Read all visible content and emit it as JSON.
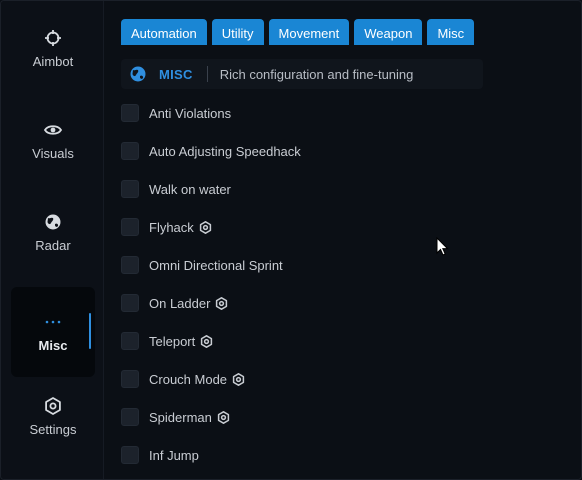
{
  "colors": {
    "accent": "#1a86d4",
    "accent_text": "#2f8fe0",
    "background": "#0b0f15"
  },
  "sidebar": {
    "items": [
      {
        "label": "Aimbot",
        "icon": "crosshair-icon",
        "active": false
      },
      {
        "label": "Visuals",
        "icon": "eye-icon",
        "active": false
      },
      {
        "label": "Radar",
        "icon": "globe-icon",
        "active": false
      },
      {
        "label": "Misc",
        "icon": "dots-icon",
        "active": true
      },
      {
        "label": "Settings",
        "icon": "settings-gear-icon",
        "active": false
      }
    ]
  },
  "tabs": [
    "Automation",
    "Utility",
    "Movement",
    "Weapon",
    "Misc"
  ],
  "section": {
    "title": "MISC",
    "description": "Rich configuration and fine-tuning",
    "icon": "globe-icon"
  },
  "options": [
    {
      "label": "Anti Violations",
      "checked": false,
      "has_settings": false
    },
    {
      "label": "Auto Adjusting Speedhack",
      "checked": false,
      "has_settings": false
    },
    {
      "label": "Walk on water",
      "checked": false,
      "has_settings": false
    },
    {
      "label": "Flyhack",
      "checked": false,
      "has_settings": true
    },
    {
      "label": "Omni Directional Sprint",
      "checked": false,
      "has_settings": false
    },
    {
      "label": "On Ladder",
      "checked": false,
      "has_settings": true
    },
    {
      "label": "Teleport",
      "checked": false,
      "has_settings": true
    },
    {
      "label": "Crouch Mode",
      "checked": false,
      "has_settings": true
    },
    {
      "label": "Spiderman",
      "checked": false,
      "has_settings": true
    },
    {
      "label": "Inf Jump",
      "checked": false,
      "has_settings": false
    }
  ]
}
